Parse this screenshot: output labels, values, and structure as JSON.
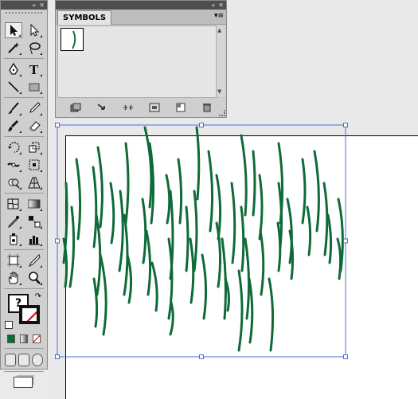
{
  "symbols_panel": {
    "tab_label": "SYMBOLS",
    "menu_icon": "panel-menu-icon",
    "footer_buttons": [
      "symbol-libraries-menu-icon",
      "place-symbol-instance-icon",
      "break-link-icon",
      "symbol-options-icon",
      "new-symbol-icon",
      "delete-symbol-icon"
    ]
  },
  "tools_panel": {
    "tools": [
      [
        "selection-tool",
        "direct-selection-tool"
      ],
      [
        "magic-wand-tool",
        "lasso-tool"
      ],
      [
        "pen-tool",
        "type-tool"
      ],
      [
        "line-segment-tool",
        "rectangle-tool"
      ],
      [
        "paintbrush-tool",
        "pencil-tool"
      ],
      [
        "blob-brush-tool",
        "eraser-tool"
      ],
      [
        "rotate-tool",
        "scale-tool"
      ],
      [
        "width-tool",
        "free-transform-tool"
      ],
      [
        "shape-builder-tool",
        "perspective-grid-tool"
      ],
      [
        "mesh-tool",
        "gradient-tool"
      ],
      [
        "eyedropper-tool",
        "blend-tool"
      ],
      [
        "symbol-sprayer-tool",
        "column-graph-tool"
      ],
      [
        "artboard-tool",
        "slice-tool"
      ],
      [
        "hand-tool",
        "zoom-tool"
      ]
    ],
    "fill_label": "?"
  },
  "colors": {
    "brush_stroke": "#0e6b38",
    "selection": "#4a6fd8",
    "panel_bg": "#cfcfcf",
    "titlebar": "#4e4e4e"
  }
}
